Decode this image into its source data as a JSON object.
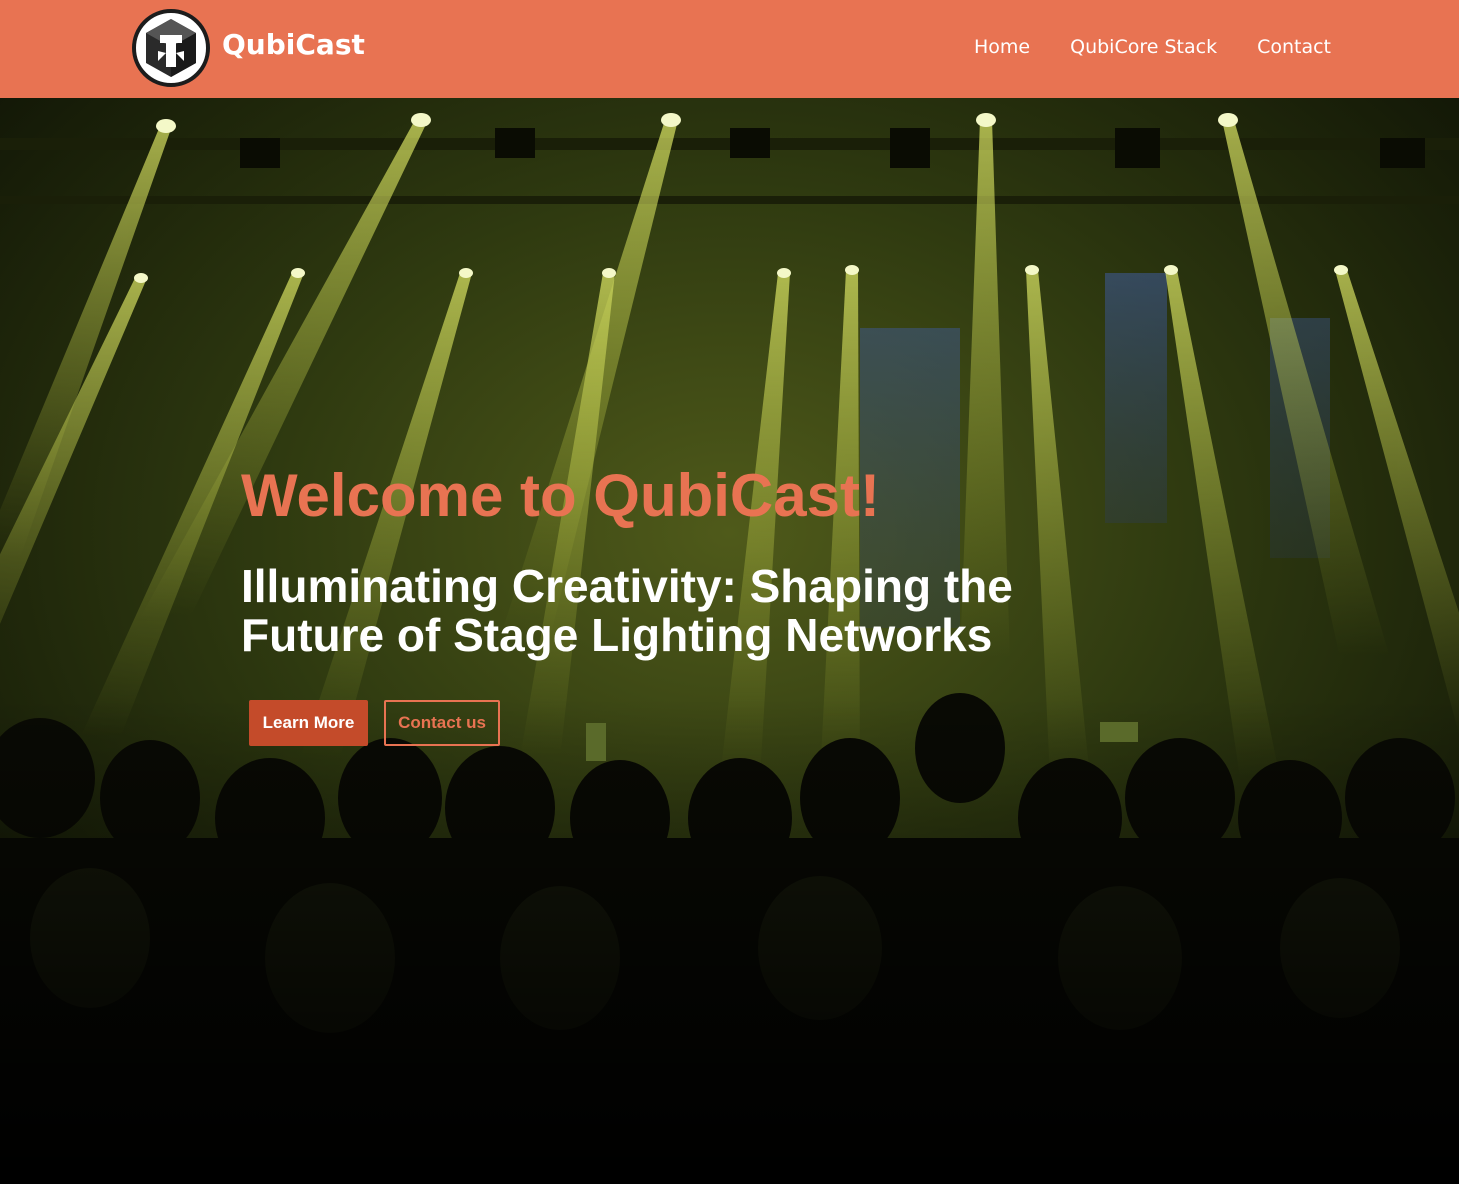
{
  "nav": {
    "brand": "QubiCast",
    "links": [
      "Home",
      "QubiCore Stack",
      "Contact"
    ]
  },
  "hero": {
    "title": "Welcome to QubiCast!",
    "tagline": "Illuminating Creativity: Shaping the Future of Stage Lighting Networks",
    "buttons": {
      "learn_more": "Learn More",
      "contact": "Contact us"
    }
  },
  "colors": {
    "accent": "#e87352",
    "button_primary": "#c44b2a",
    "text_light": "#ffffff"
  },
  "icons": {
    "logo": "qubicast-logo-icon"
  }
}
